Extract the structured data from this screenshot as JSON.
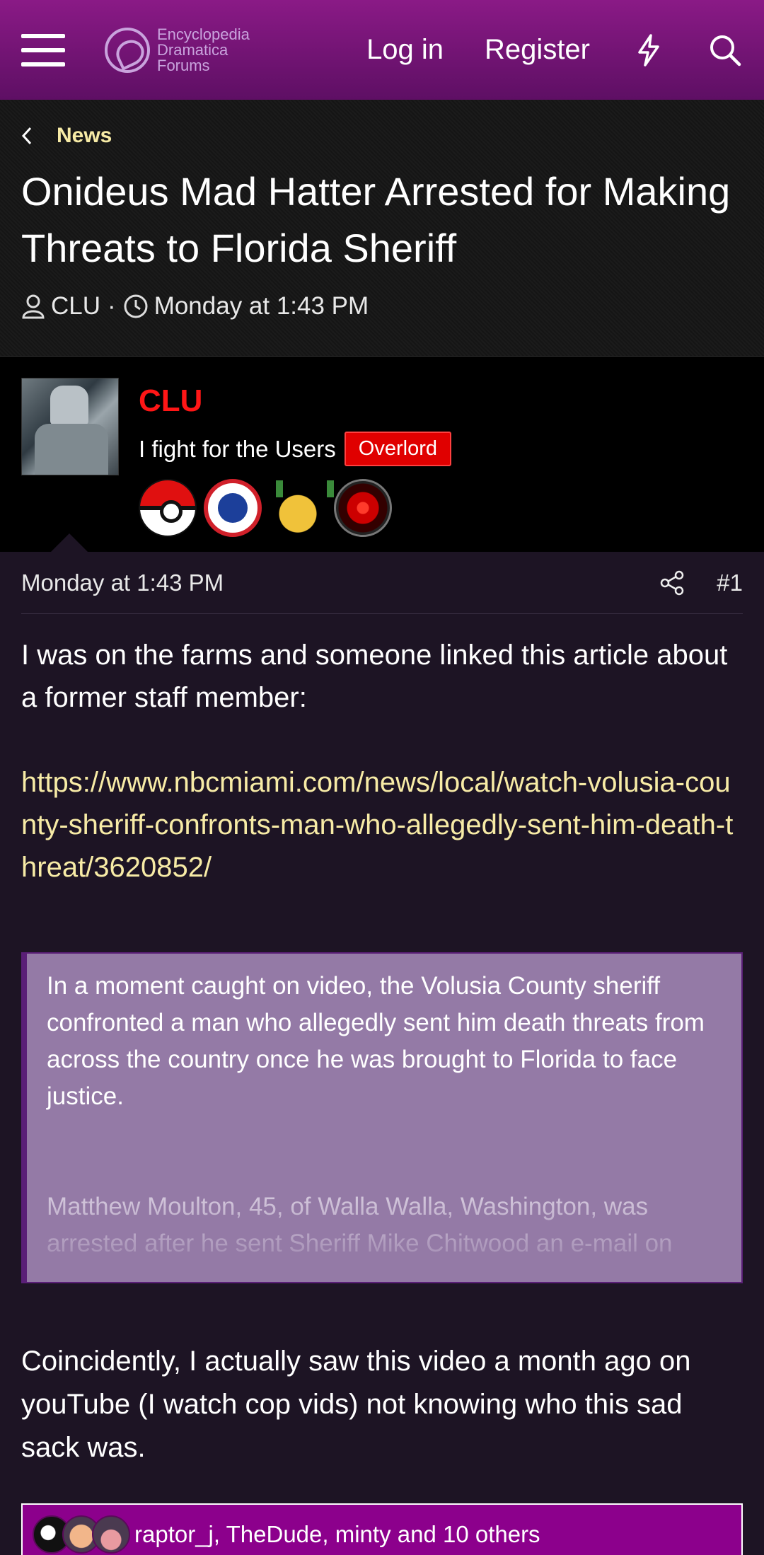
{
  "nav": {
    "logo_text": [
      "Encyclopedia",
      "Dramatica",
      "Forums"
    ],
    "login": "Log in",
    "register": "Register"
  },
  "breadcrumb": {
    "label": "News"
  },
  "thread": {
    "title": "Onideus Mad Hatter Arrested for Making Threats to Florida Sheriff",
    "author": "CLU",
    "sep": "·",
    "date": "Monday at 1:43 PM"
  },
  "user": {
    "name": "CLU",
    "title": "I fight for the Users",
    "badge": "Overlord",
    "colors": {
      "name": "#ff1616",
      "badge": "#e00000"
    }
  },
  "post": {
    "date": "Monday at 1:43 PM",
    "number": "#1",
    "intro": "I was on the farms and someone linked this article about a former staff member:",
    "link": "https://www.nbcmiami.com/news/local/watch-volusia-county-sheriff-confronts-man-who-allegedly-sent-him-death-threat/3620852/",
    "quote_p1": "In a moment caught on video, the Volusia County sheriff confronted a man who allegedly sent him death threats from across the country once he was brought to Florida to face justice.",
    "quote_p2": "Matthew Moulton, 45, of Walla Walla, Washington, was arrested after he sent Sheriff Mike Chitwood an e-mail on",
    "outro": "Coincidently, I actually saw this video a month ago on youTube (I watch cop vids) not knowing who this sad sack was.",
    "reactions_text": "raptor_j, TheDude, minty and 10 others"
  },
  "theme": {
    "accent": "#8a1a86",
    "link": "#f7eba6",
    "quote_bg": "#947aa6"
  }
}
